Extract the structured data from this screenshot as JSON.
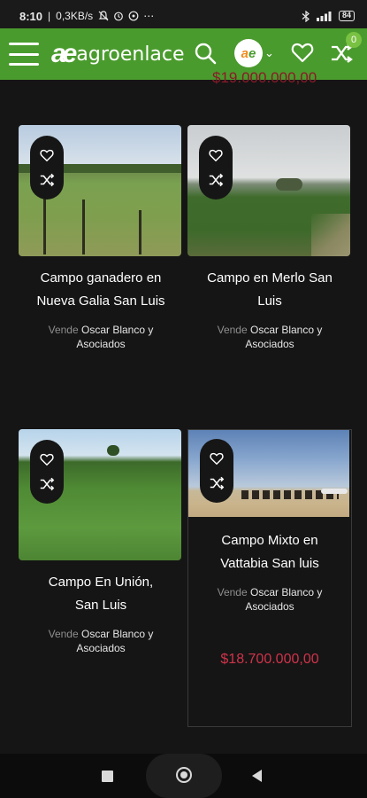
{
  "status_bar": {
    "time": "8:10",
    "speed": "0,3KB/s",
    "battery": "84"
  },
  "header": {
    "brand_mark": "ae",
    "brand_name": "agroenlace",
    "compare_count": "0",
    "avatar_a": "a",
    "avatar_e": "e"
  },
  "cut_off_price": "$19.000.000,00",
  "listings": [
    {
      "title_line1": "Campo ganadero en",
      "title_line2": "Nueva Galia San Luis",
      "seller_label": "Vende",
      "seller_name_line1": "Oscar Blanco y",
      "seller_name_line2": "Asociados"
    },
    {
      "title_line1": "Campo en Merlo San",
      "title_line2": "Luis",
      "seller_label": "Vende",
      "seller_name_line1": "Oscar Blanco y",
      "seller_name_line2": "Asociados"
    },
    {
      "title_line1": "Campo En Unión,",
      "title_line2": "San Luis",
      "seller_label": "Vende",
      "seller_name_line1": "Oscar Blanco y",
      "seller_name_line2": "Asociados"
    },
    {
      "title_line1": "Campo Mixto en",
      "title_line2": "Vattabia San luis",
      "seller_label": "Vende",
      "seller_name_line1": "Oscar Blanco y",
      "seller_name_line2": "Asociados",
      "price": "$18.700.000,00"
    }
  ],
  "colors": {
    "brand_green": "#4a9b2d",
    "price_red": "#d0334a",
    "background": "#151515"
  }
}
